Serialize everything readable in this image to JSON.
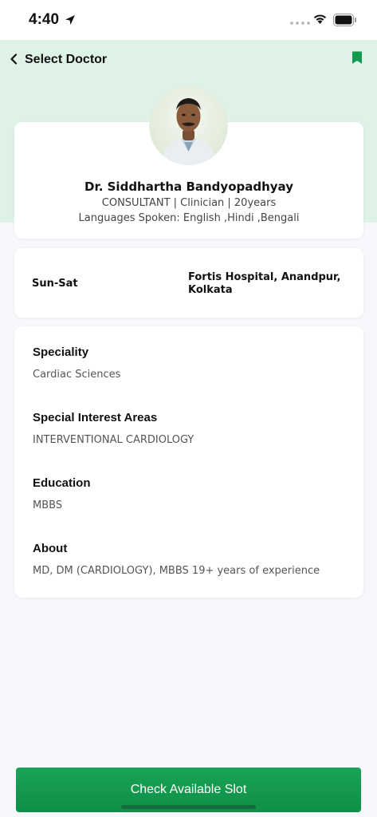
{
  "status_bar": {
    "time": "4:40"
  },
  "header": {
    "back_label": "Select Doctor"
  },
  "doctor": {
    "name": "Dr. Siddhartha Bandyopadhyay",
    "role_line": "CONSULTANT | Clinician | 20years",
    "languages_line": "Languages Spoken: English ,Hindi ,Bengali"
  },
  "schedule": {
    "days": "Sun-Sat",
    "hospital": "Fortis Hospital, Anandpur, Kolkata"
  },
  "details": [
    {
      "title": "Speciality",
      "value": "Cardiac Sciences"
    },
    {
      "title": "Special Interest Areas",
      "value": "INTERVENTIONAL CARDIOLOGY"
    },
    {
      "title": "Education",
      "value": "MBBS"
    },
    {
      "title": "About",
      "value": "MD, DM (CARDIOLOGY), MBBS 19+ years of experience"
    }
  ],
  "cta": {
    "label": "Check Available Slot"
  },
  "colors": {
    "accent": "#129a4e",
    "header_bg": "#dff2e8",
    "page_bg": "#f6f8fb"
  },
  "icons": [
    "location-arrow-icon",
    "wifi-icon",
    "battery-icon",
    "chevron-left-icon",
    "bookmark-icon"
  ]
}
